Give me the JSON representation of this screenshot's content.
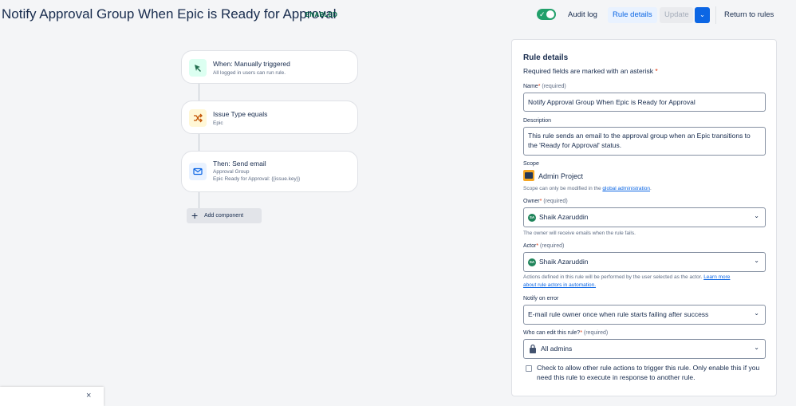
{
  "header": {
    "title": "Notify Approval Group When Epic is Ready for Approval",
    "status_badge": "ENABLED",
    "toggle_check": "✓",
    "audit_log": "Audit log",
    "rule_details": "Rule details",
    "update": "Update",
    "dropdown_icon": "⌄",
    "return": "Return to rules"
  },
  "flow": {
    "trigger": {
      "title": "When: Manually triggered",
      "subtitle": "All logged in users can run rule.",
      "icon": "pointer-click-icon"
    },
    "condition": {
      "title": "Issue Type equals",
      "subtitle": "Epic",
      "icon": "shuffle-icon"
    },
    "action": {
      "title": "Then: Send email",
      "subtitle": "Approval Group",
      "subtitle2": "Epic Ready for Approval: {{issue.key}}",
      "icon": "mail-icon"
    },
    "add_component": "Add component",
    "add_icon": "+"
  },
  "toast": {
    "close": "×"
  },
  "panel": {
    "title": "Rule details",
    "required_note": "Required fields are marked with an asterisk",
    "asterisk": "*",
    "name_label": "Name",
    "required": "(required)",
    "name_value": "Notify Approval Group When Epic is Ready for Approval",
    "description_label": "Description",
    "description_value": "This rule sends an email to the approval group when an Epic transitions to the 'Ready for Approval' status.",
    "scope_label": "Scope",
    "scope_value": "Admin Project",
    "scope_help_prefix": "Scope can only be modified in the",
    "scope_help_link": "global administration",
    "scope_help_suffix": ".",
    "owner_label": "Owner",
    "owner_value": "Shaik Azaruddin",
    "owner_initials": "SA",
    "owner_help": "The owner will receive emails when the rule fails.",
    "actor_label": "Actor",
    "actor_value": "Shaik Azaruddin",
    "actor_initials": "SA",
    "actor_help": "Actions defined in this rule will be performed by the user selected as the actor.",
    "actor_help_link1": "Learn more",
    "actor_help_link2": "about rule actors in automation.",
    "notify_label": "Notify on error",
    "notify_value": "E-mail rule owner once when rule starts failing after success",
    "edit_label": "Who can edit this rule?",
    "edit_value": "All admins",
    "checkbox_text": "Check to allow other rule actions to trigger this rule. Only enable this if you need this rule to execute in response to another rule.",
    "chevron": "⌄"
  },
  "colors": {
    "accent": "#0c66e4",
    "success": "#22a06b",
    "enabled_text": "#006644"
  }
}
